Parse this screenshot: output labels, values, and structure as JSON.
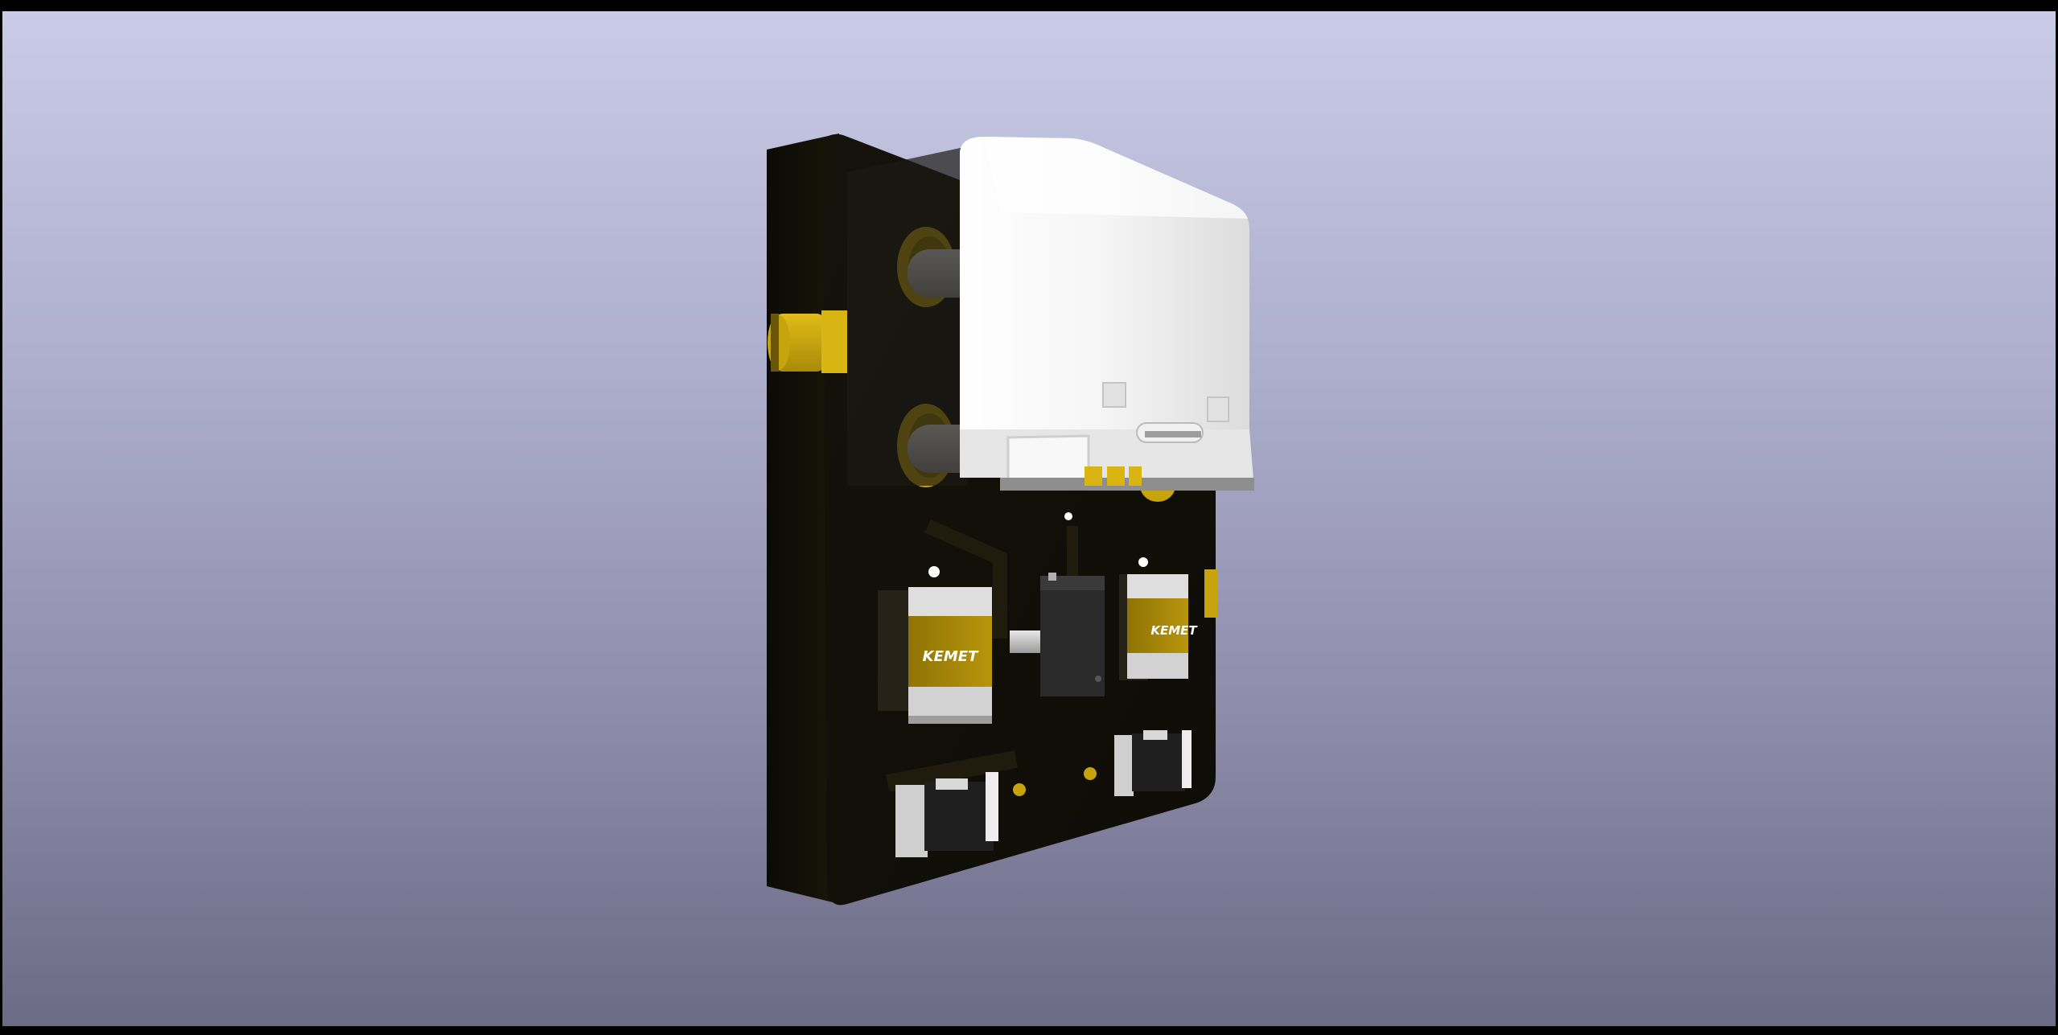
{
  "viewer": {
    "background_top": "#cacbe6",
    "background_bottom": "#6c6b85",
    "frame_color": "#000000"
  },
  "pcb": {
    "board_color": "#141208",
    "copper_color": "#c8a40c",
    "connector_color": "#f2f2f2"
  },
  "components": {
    "cap_left": {
      "label": "KEMET"
    },
    "cap_right": {
      "label": "KEMET"
    }
  }
}
